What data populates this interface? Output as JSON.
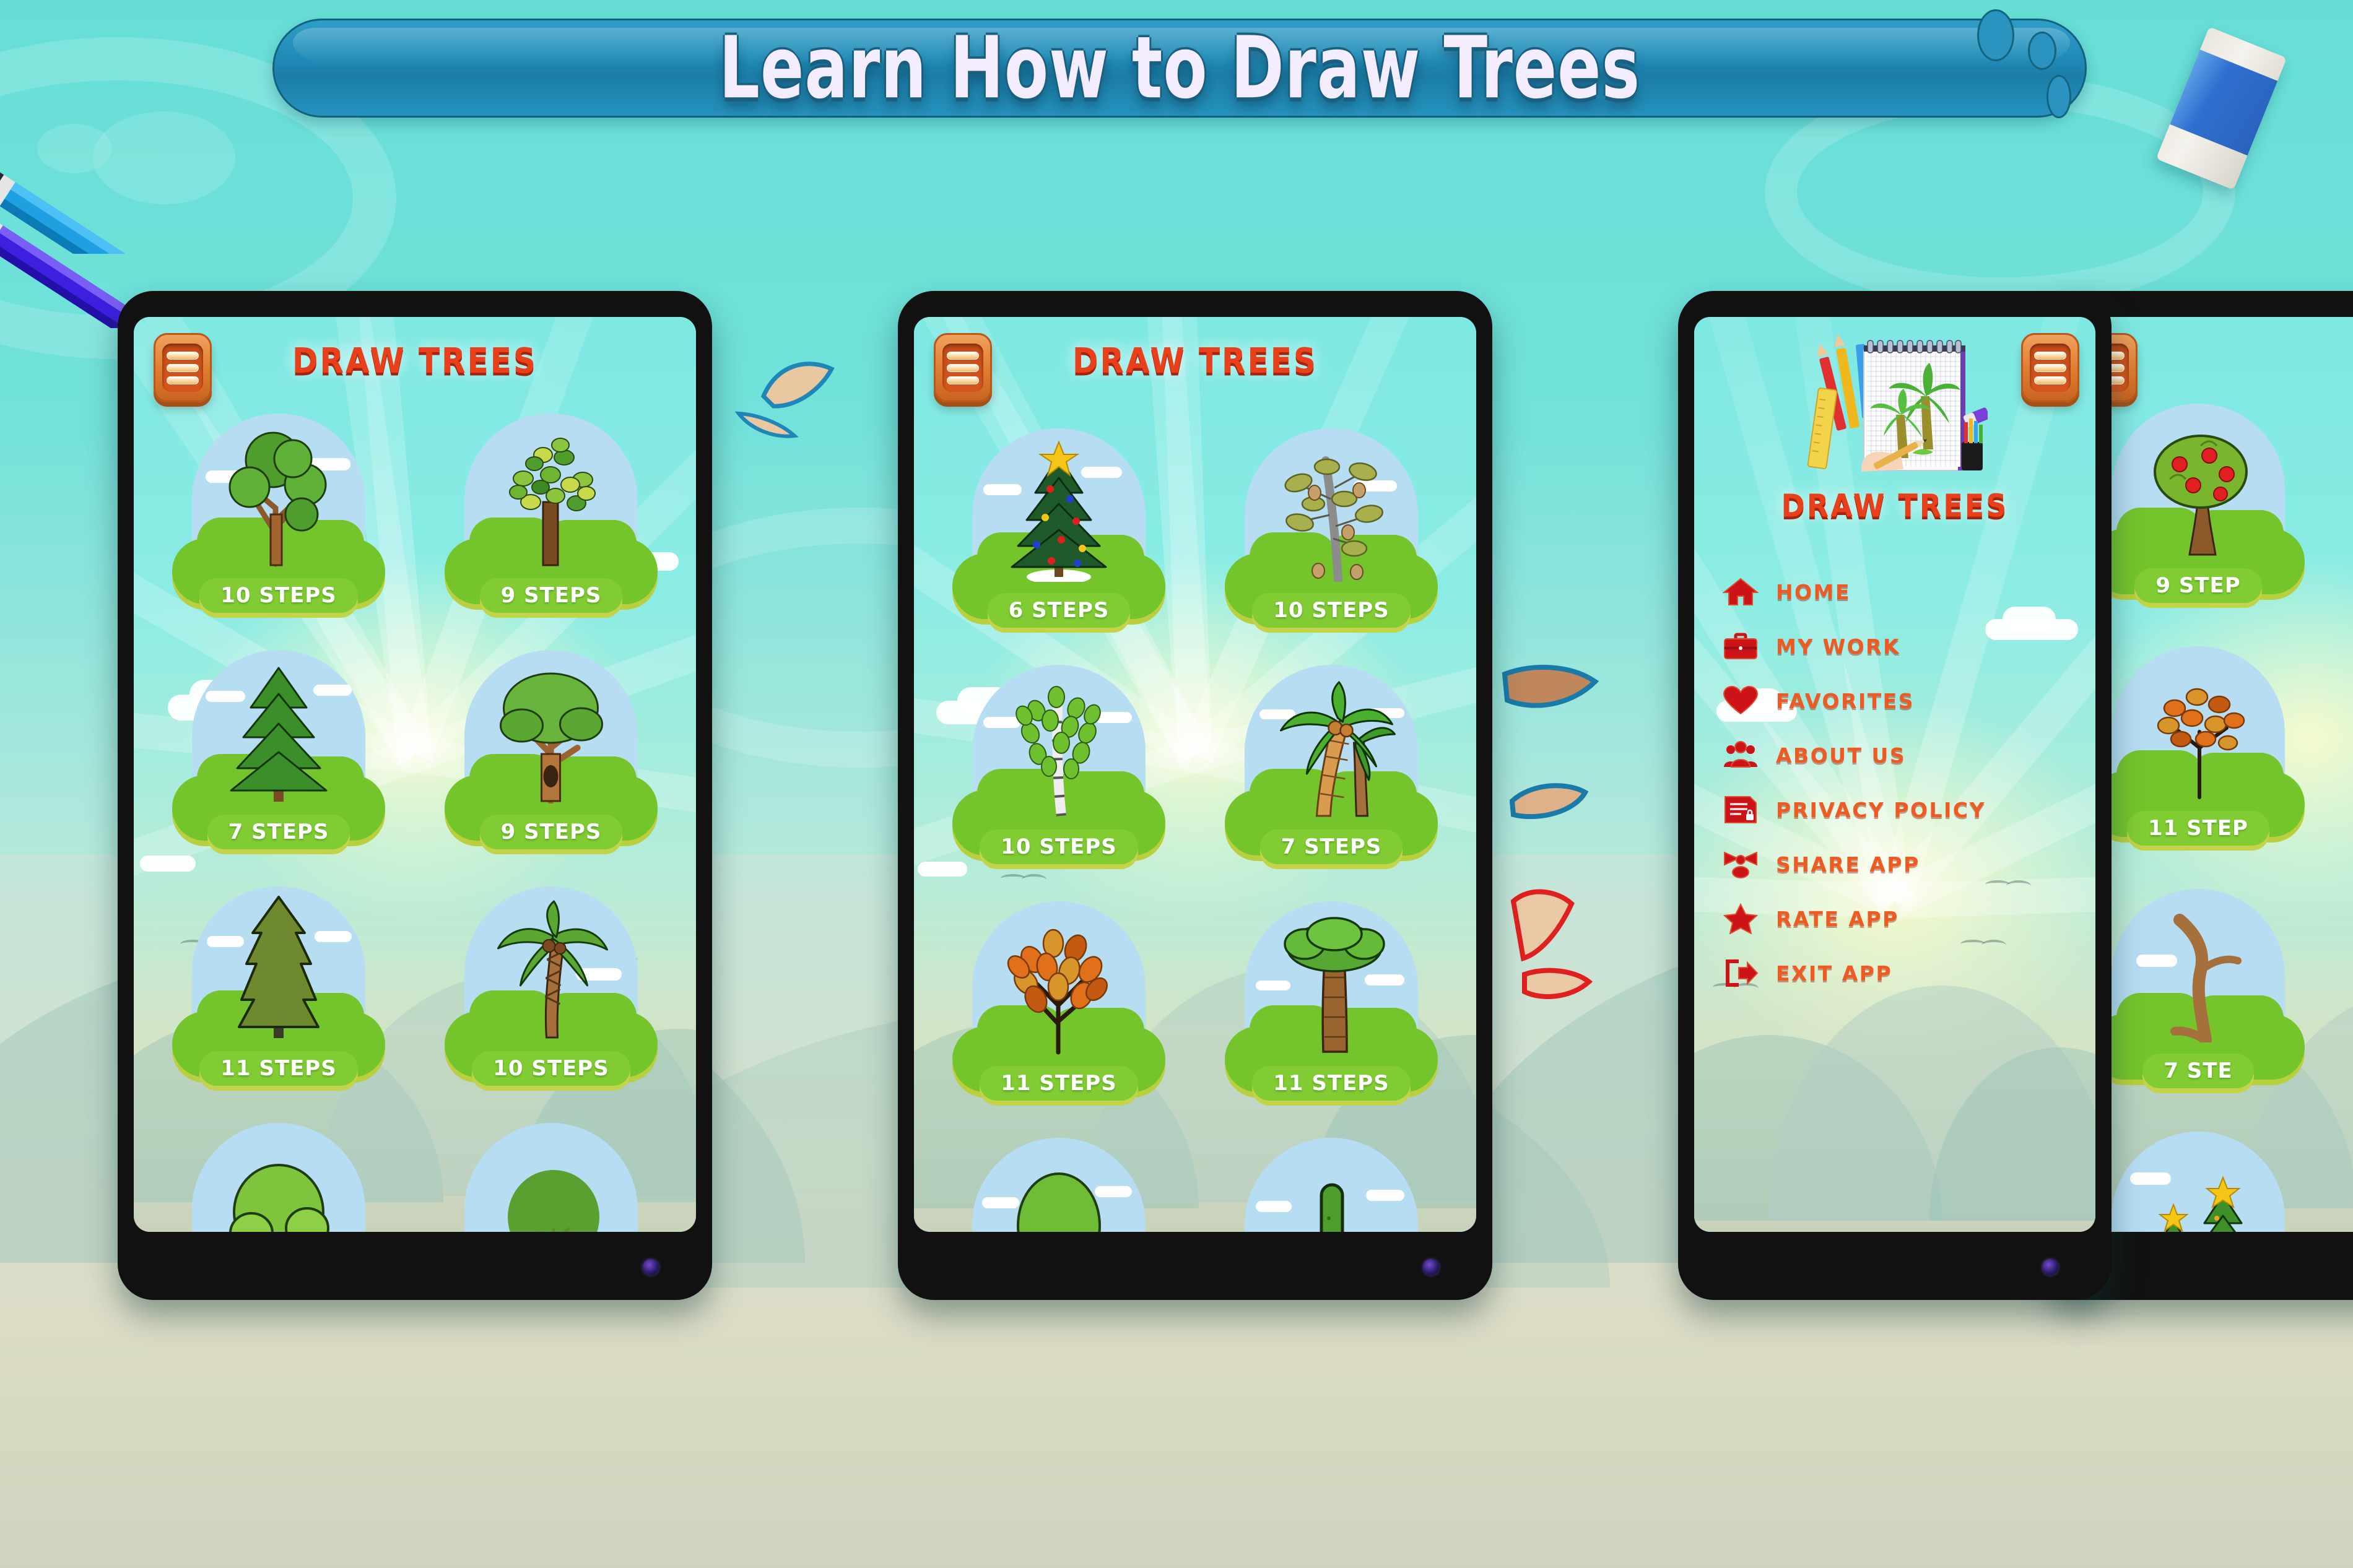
{
  "banner": {
    "title": "Learn How to Draw Trees"
  },
  "decor": {
    "pencil_blue": "pencil-blue",
    "pencil_purple": "pencil-purple",
    "eraser": "eraser",
    "shavings": [
      "pencil-shaving-blue-1",
      "pencil-shaving-blue-2",
      "pencil-shaving-blue-3",
      "pencil-shaving-blue-4",
      "pencil-shaving-red-1",
      "pencil-shaving-red-2"
    ]
  },
  "phones": [
    {
      "id": "phone-1",
      "header": {
        "menu_icon": "hamburger-icon",
        "title": "DRAW TREES"
      },
      "grid": [
        [
          {
            "tree": "oak-branching-tree",
            "steps": "10 STEPS"
          },
          {
            "tree": "leafy-green-tree",
            "steps": "9 STEPS"
          }
        ],
        [
          {
            "tree": "fir-pine-tree",
            "steps": "7 STEPS"
          },
          {
            "tree": "hollow-trunk-tree",
            "steps": "9 STEPS"
          }
        ],
        [
          {
            "tree": "tall-spruce-tree",
            "steps": "11 STEPS"
          },
          {
            "tree": "coconut-palm-tree",
            "steps": "10 STEPS"
          }
        ],
        [
          {
            "tree": "bushy-light-tree",
            "steps": ""
          },
          {
            "tree": "round-dark-tree",
            "steps": ""
          }
        ]
      ]
    },
    {
      "id": "phone-2",
      "header": {
        "menu_icon": "hamburger-icon",
        "title": "DRAW TREES"
      },
      "grid": [
        [
          {
            "tree": "christmas-tree",
            "steps": "6 STEPS"
          },
          {
            "tree": "oak-acorn-tree",
            "steps": "10 STEPS"
          }
        ],
        [
          {
            "tree": "birch-tree",
            "steps": "10 STEPS"
          },
          {
            "tree": "palm-tree-pair",
            "steps": "7 STEPS"
          }
        ],
        [
          {
            "tree": "autumn-orange-tree",
            "steps": "11 STEPS"
          },
          {
            "tree": "baobab-tree",
            "steps": "11 STEPS"
          }
        ],
        [
          {
            "tree": "pale-trunk-tree",
            "steps": ""
          },
          {
            "tree": "cactus",
            "steps": ""
          }
        ]
      ]
    },
    {
      "id": "phone-3",
      "header": {
        "menu_icon": "hamburger-icon"
      },
      "drawer": {
        "logo_icon": "notepad-palm-drawing-logo",
        "logo_caption": "DRAW TREES",
        "items": [
          {
            "icon": "home-icon",
            "label": "HOME"
          },
          {
            "icon": "briefcase-icon",
            "label": "MY WORK"
          },
          {
            "icon": "heart-icon",
            "label": "FAVORITES"
          },
          {
            "icon": "people-icon",
            "label": "ABOUT US"
          },
          {
            "icon": "document-lock-icon",
            "label": "PRIVACY POLICY"
          },
          {
            "icon": "share-icon",
            "label": "SHARE APP"
          },
          {
            "icon": "star-icon",
            "label": "RATE APP"
          },
          {
            "icon": "exit-icon",
            "label": "EXIT APP"
          }
        ]
      }
    },
    {
      "id": "phone-4",
      "header": {
        "menu_icon": "hamburger-icon"
      },
      "grid": [
        [
          {
            "tree": "apple-tree",
            "steps": "9 STEP"
          }
        ],
        [
          {
            "tree": "autumn-tree",
            "steps": "11 STEP"
          }
        ],
        [
          {
            "tree": "bare-twisted-tree",
            "steps": "7 STE"
          }
        ],
        [
          {
            "tree": "christmas-tree-small",
            "steps": ""
          }
        ]
      ]
    }
  ],
  "colors": {
    "banner_blue": "#1f8cb8",
    "page_bg": "#6ee0d8",
    "app_bg": "#7ee8e2",
    "title_red": "#e8401a",
    "menu_orange": "#ee5a22",
    "menu_icon_red": "#cc1418",
    "grass_green": "#74c42c",
    "steps_green": "#82cc33",
    "hamburger_orange": "#e07f32",
    "dome_blue": "#b7ddf3"
  }
}
